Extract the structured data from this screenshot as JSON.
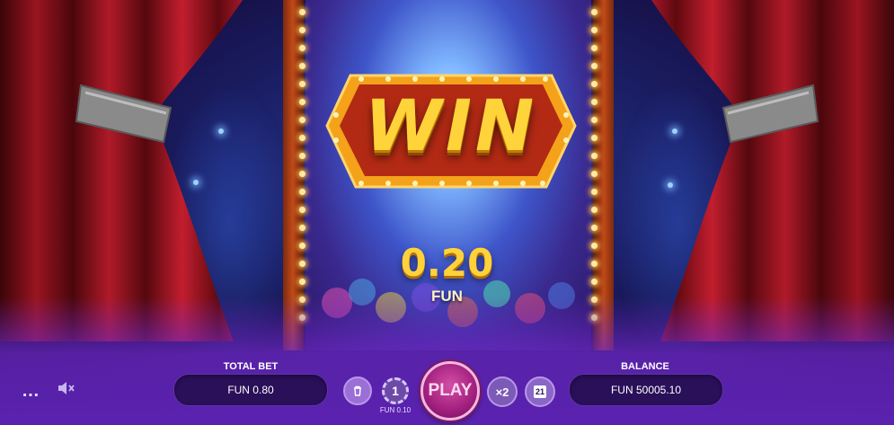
{
  "game": {
    "win_title": "WIN",
    "win_amount": "0.20",
    "win_currency": "FUN"
  },
  "controls": {
    "menu_icon": "…",
    "sound_icon": "mute-icon",
    "total_bet_label": "TOTAL BET",
    "total_bet_value": "FUN 0.80",
    "clear_icon": "trash-icon",
    "chip_value": "1",
    "chip_label": "FUN 0.10",
    "play_label": "PLAY",
    "multiplier_label": "×2",
    "autoplay_icon": "calendar-icon",
    "autoplay_value": "21",
    "balance_label": "BALANCE",
    "balance_value": "FUN 50005.10"
  },
  "colors": {
    "accent_gold": "#ffd23a",
    "play_button": "#a11f7e",
    "panel_bg": "#2a0f59",
    "button_purple": "#9a6fd6"
  }
}
